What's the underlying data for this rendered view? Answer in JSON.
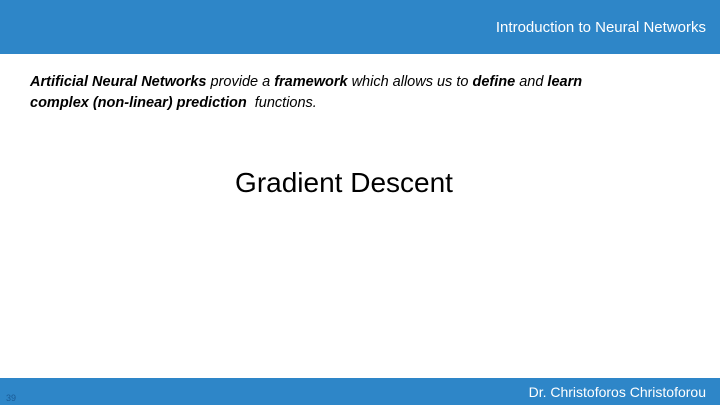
{
  "header": {
    "title": "Introduction to Neural Networks"
  },
  "intro": {
    "parts": [
      "Artificial Neural Networks",
      " provide a ",
      "framework",
      " which allows us to ",
      "define",
      " and ",
      "learn",
      " ",
      "complex (non-linear) prediction",
      "  functions."
    ]
  },
  "slide": {
    "heading": "Gradient Descent",
    "number": "39"
  },
  "footer": {
    "author": "Dr. Christoforos Christoforou"
  },
  "colors": {
    "bar": "#2e86c8",
    "bar_text": "#ffffff",
    "slide_number": "#1a5b96"
  }
}
